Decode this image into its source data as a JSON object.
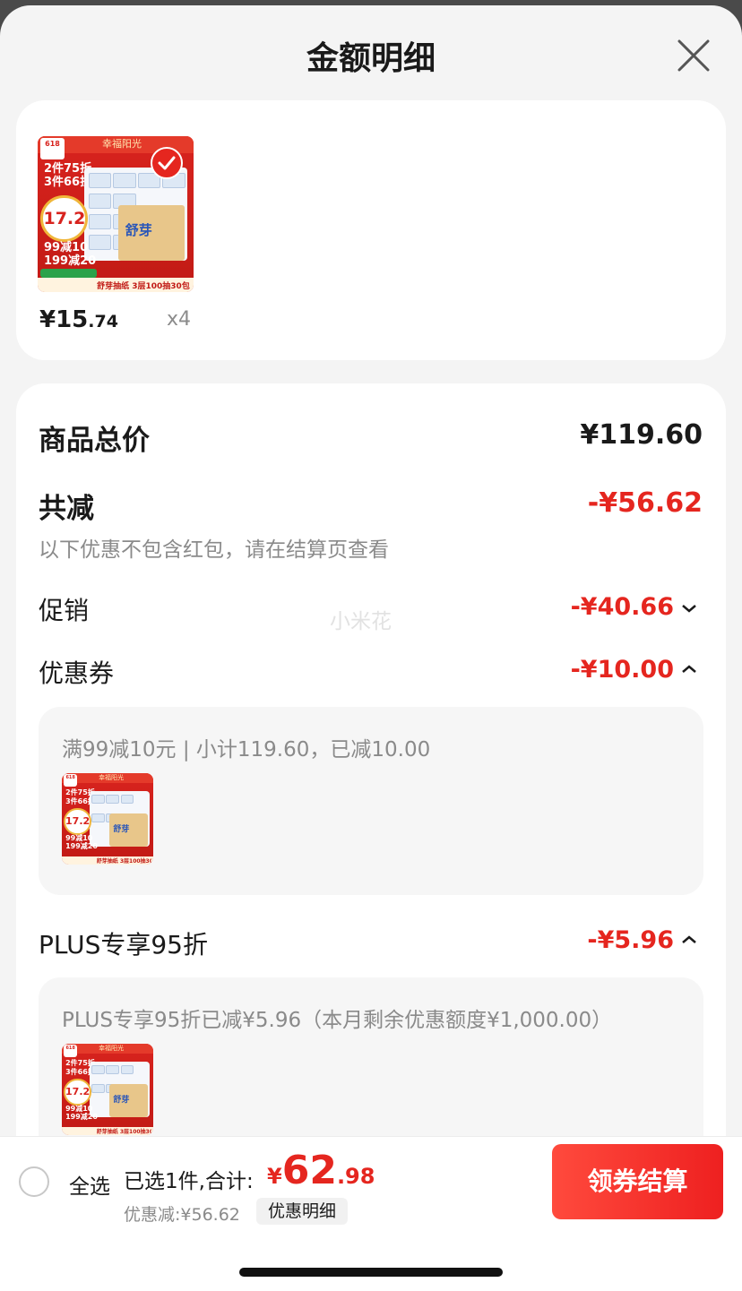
{
  "header": {
    "title": "金额明细",
    "close_icon": "close-icon"
  },
  "product": {
    "thumbnail": {
      "brand": "幸福阳光",
      "badge_618": "618",
      "promo_lines": [
        "2件75折",
        "3件66折"
      ],
      "price_circle": "17.2",
      "sub_lines": [
        "99减10",
        "199减20"
      ],
      "pack_label": "舒芽",
      "bottom_label": "舒芽抽纸 3层100抽30包"
    },
    "price_int": "¥15",
    "price_dec": ".74",
    "quantity": "x4",
    "selected": true
  },
  "summary": {
    "total_label": "商品总价",
    "total_value": "¥119.60",
    "reduce_label": "共减",
    "reduce_value": "-¥56.62",
    "note": "以下优惠不包含红包，请在结算页查看",
    "watermark": "小米花",
    "promo_label": "促销",
    "promo_value": "-¥40.66",
    "coupon_label": "优惠券",
    "coupon_value": "-¥10.00",
    "coupon_detail": "满99减10元 | 小计119.60，已减10.00",
    "plus_label": "PLUS专享95折",
    "plus_value": "-¥5.96",
    "plus_detail": "PLUS专享95折已减¥5.96（本月剩余优惠额度¥1,000.00）"
  },
  "bottom_bar": {
    "select_all": "全选",
    "selected_info": "已选1件,合计:",
    "total_currency": "¥",
    "total_int": "62",
    "total_dec": ".98",
    "discount": "优惠减:¥56.62",
    "detail_link": "优惠明细",
    "checkout": "领券结算"
  },
  "colors": {
    "accent_red": "#e5261f",
    "background": "#f4f4f4"
  }
}
